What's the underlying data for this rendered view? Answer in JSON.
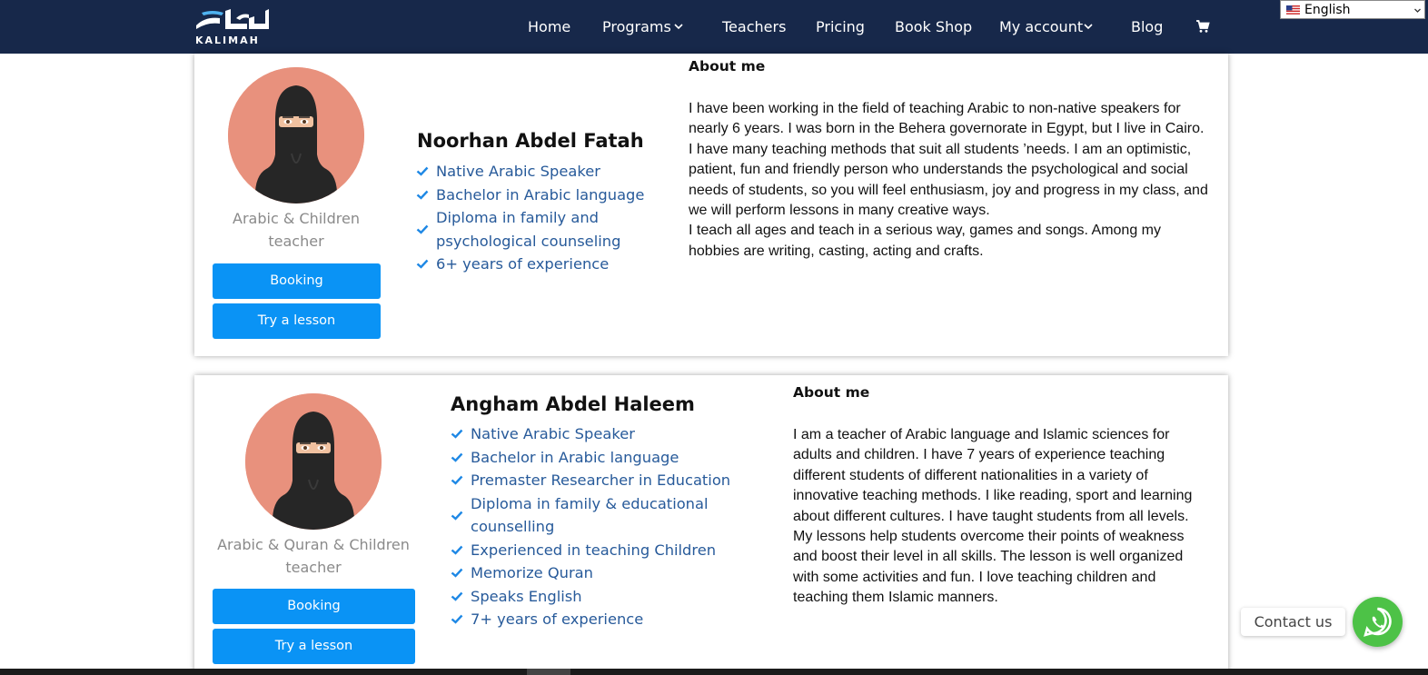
{
  "header": {
    "logo_text": "KALIMAH",
    "nav": [
      {
        "label": "Home",
        "has_dropdown": false
      },
      {
        "label": "Programs",
        "has_dropdown": true
      },
      {
        "label": "Teachers",
        "has_dropdown": false
      },
      {
        "label": "Pricing",
        "has_dropdown": false
      },
      {
        "label": "Book Shop",
        "has_dropdown": false
      },
      {
        "label": "My account",
        "has_dropdown": true
      },
      {
        "label": "Blog",
        "has_dropdown": false
      }
    ],
    "cart_icon": "cart-icon",
    "language": {
      "selected": "English",
      "flag": "us-flag-icon"
    }
  },
  "teachers": [
    {
      "name": "Noorhan Abdel Fatah",
      "role_line1": "Arabic & Children",
      "role_line2": "teacher",
      "booking_label": "Booking",
      "try_label": "Try a lesson",
      "qualifications": [
        "Native Arabic Speaker",
        "Bachelor in Arabic language",
        "Diploma in family and psychological counseling",
        "6+ years of experience"
      ],
      "about_heading": "About me",
      "about_lines": [
        "I have been working in the field of teaching Arabic to non-native speakers for",
        "nearly 6 years. I was born in the Behera governorate in Egypt, but I live in Cairo.",
        "I have many teaching methods that suit all students ’needs. I am an optimistic,",
        "patient, fun and friendly person who understands the psychological and social",
        "needs of students, so you will feel enthusiasm, joy and progress in my class, and",
        "we will perform lessons in many creative ways.",
        "I teach all ages and teach in a serious way, games and songs. Among my",
        "hobbies are writing, casting, acting and crafts."
      ]
    },
    {
      "name": "Angham Abdel Haleem",
      "role_line1": "Arabic & Quran & Children",
      "role_line2": "teacher",
      "booking_label": "Booking",
      "try_label": "Try a lesson",
      "qualifications": [
        "Native Arabic Speaker",
        "Bachelor in Arabic language",
        "Premaster Researcher in Education",
        "Diploma in family & educational counselling",
        "Experienced in teaching Children",
        "Memorize Quran",
        "Speaks English",
        "7+ years of experience"
      ],
      "about_heading": "About me",
      "about_lines": [
        "I am a teacher of Arabic language and Islamic sciences for",
        "adults and children. I have 7 years of experience teaching",
        "different students of different nationalities in a variety of",
        "innovative teaching methods. I like reading, sport and learning",
        "about different cultures. I have taught students from all levels.",
        "My lessons help students overcome their points of weakness",
        "and boost their level in all skills. The lesson is well organized",
        "with some activities and fun. I love teaching children and",
        "teaching them Islamic manners."
      ]
    }
  ],
  "contact": {
    "label": "Contact us",
    "icon": "whatsapp-icon"
  },
  "colors": {
    "header_bg": "#17284a",
    "button": "#0a93f5",
    "qualification_text": "#275a9a",
    "check": "#1e88e5",
    "avatar_bg": "#e8917d",
    "whatsapp": "#4dc247"
  }
}
